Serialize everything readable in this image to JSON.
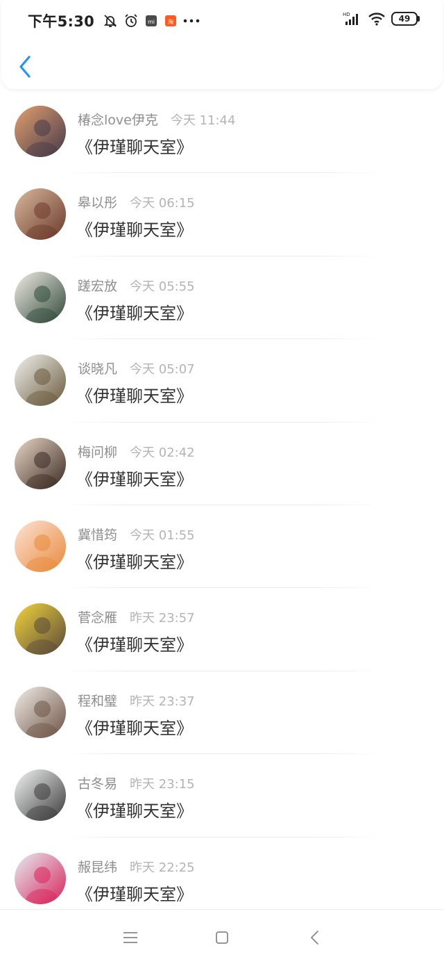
{
  "status": {
    "time": "下午5:30",
    "battery": "49",
    "network_tag": "HD"
  },
  "header": {
    "back_icon": "chevron-left-icon",
    "accent": "#2196f3"
  },
  "messages": [
    {
      "name": "椿念love伊克",
      "time": "今天 11:44",
      "text": "《伊瑾聊天室》",
      "avatar_colors": [
        "#e3a06f",
        "#463a4a"
      ]
    },
    {
      "name": "皋以彤",
      "time": "今天 06:15",
      "text": "《伊瑾聊天室》",
      "avatar_colors": [
        "#d9b89c",
        "#6b3a2a"
      ]
    },
    {
      "name": "蹉宏放",
      "time": "今天 05:55",
      "text": "《伊瑾聊天室》",
      "avatar_colors": [
        "#f3ece6",
        "#2f4a3a"
      ]
    },
    {
      "name": "谈晓凡",
      "time": "今天 05:07",
      "text": "《伊瑾聊天室》",
      "avatar_colors": [
        "#f2f2ef",
        "#6b5a3d"
      ]
    },
    {
      "name": "梅问柳",
      "time": "今天 02:42",
      "text": "《伊瑾聊天室》",
      "avatar_colors": [
        "#e9d7c7",
        "#3b2a22"
      ]
    },
    {
      "name": "冀惜筠",
      "time": "今天 01:55",
      "text": "《伊瑾聊天室》",
      "avatar_colors": [
        "#fde3d5",
        "#e88a3c"
      ]
    },
    {
      "name": "菅念雁",
      "time": "昨天 23:57",
      "text": "《伊瑾聊天室》",
      "avatar_colors": [
        "#f2d43c",
        "#5a4a3a"
      ]
    },
    {
      "name": "程和璧",
      "time": "昨天 23:37",
      "text": "《伊瑾聊天室》",
      "avatar_colors": [
        "#f1ede8",
        "#6e5446"
      ]
    },
    {
      "name": "古冬易",
      "time": "昨天 23:15",
      "text": "《伊瑾聊天室》",
      "avatar_colors": [
        "#f4f6f5",
        "#3a3a3a"
      ]
    },
    {
      "name": "赧昆纬",
      "time": "昨天 22:25",
      "text": "《伊瑾聊天室》",
      "avatar_colors": [
        "#e5eef2",
        "#d8245c"
      ]
    }
  ],
  "navbar": {
    "menu_icon": "menu-icon",
    "home_icon": "home-square-icon",
    "back_icon": "back-triangle-icon"
  }
}
